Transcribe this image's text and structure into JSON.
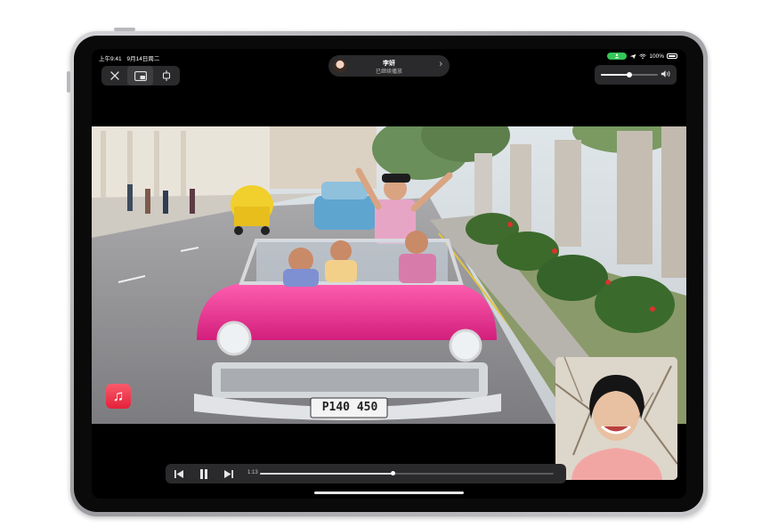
{
  "status_bar": {
    "time": "上午9:41",
    "date": "9月14日周二",
    "battery": "100%"
  },
  "pip_controls": {
    "close_icon": "close-icon",
    "pip_icon": "picture-in-picture-icon",
    "resize_icon": "resize-icon"
  },
  "shareplay": {
    "name": "李妍",
    "status": "已继续播放"
  },
  "volume": {
    "level": 0.5,
    "icon": "speaker-icon"
  },
  "video": {
    "license_plate": "P140 450"
  },
  "player": {
    "elapsed": "1:13",
    "progress": 0.45
  },
  "app_icon": "music-icon"
}
